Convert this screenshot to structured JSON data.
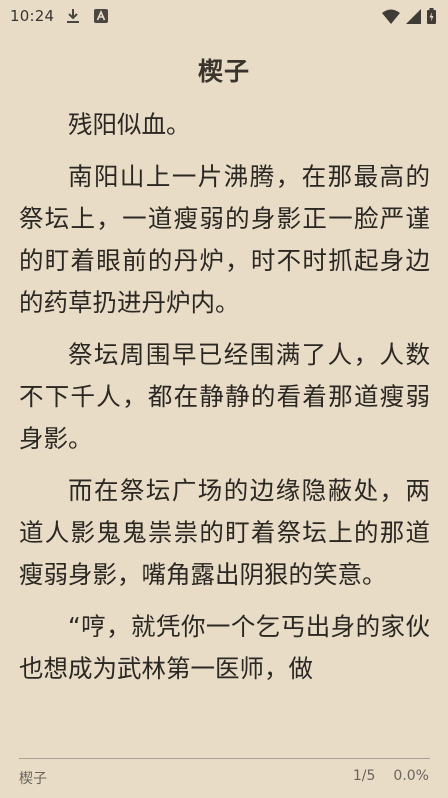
{
  "status_bar": {
    "time": "10:24",
    "icons": [
      "download-icon",
      "a-notification-icon",
      "wifi-icon",
      "signal-icon",
      "battery-icon"
    ]
  },
  "chapter": {
    "title": "楔子",
    "paragraphs": [
      "残阳似血。",
      "南阳山上一片沸腾，在那最高的祭坛上，一道瘦弱的身影正一脸严谨的盯着眼前的丹炉，时不时抓起身边的药草扔进丹炉内。",
      "祭坛周围早已经围满了人，人数不下千人，都在静静的看着那道瘦弱身影。",
      "而在祭坛广场的边缘隐蔽处，两道人影鬼鬼祟祟的盯着祭坛上的那道瘦弱身影，嘴角露出阴狠的笑意。",
      "“哼，就凭你一个乞丐出身的家伙也想成为武林第一医师，做"
    ]
  },
  "footer": {
    "chapter_title": "楔子",
    "page": "1/5",
    "progress": "0.0%"
  },
  "colors": {
    "background": "#e9dcc7",
    "text": "#2b2722",
    "footer_text": "#6a645c"
  }
}
